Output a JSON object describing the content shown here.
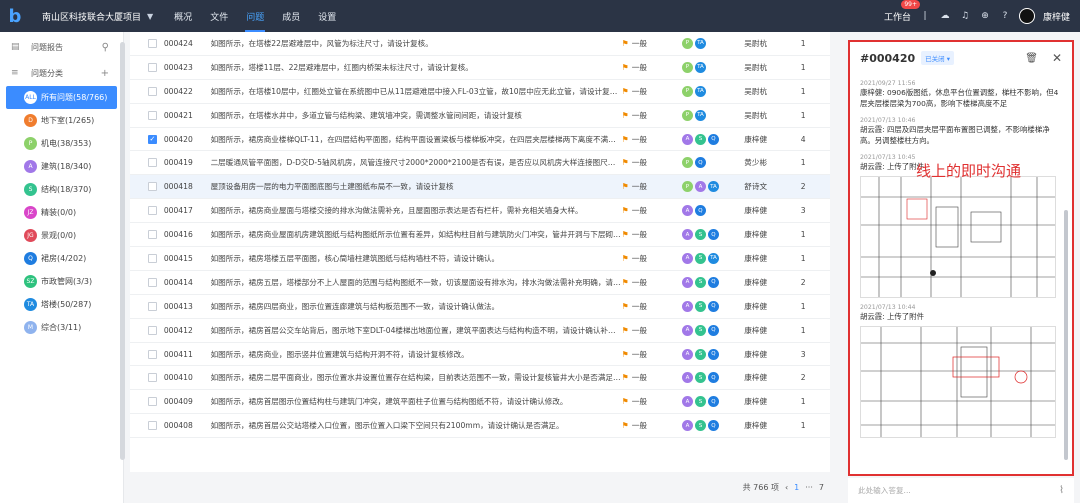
{
  "topbar": {
    "logo": "b",
    "project": "南山区科技联合大厦项目",
    "tabs": [
      "概况",
      "文件",
      "问题",
      "成员",
      "设置"
    ],
    "active_tab": 2,
    "workbench": "工作台",
    "badge": "99+",
    "user": "康梓健"
  },
  "sidebar": {
    "report": "问题报告",
    "category": "问题分类",
    "categories": [
      {
        "badge": "ALL",
        "label": "所有问题(58/766)",
        "color": "#3b8cff"
      },
      {
        "badge": "D",
        "label": "地下室(1/265)",
        "color": "#f07d2e"
      },
      {
        "badge": "P",
        "label": "机电(38/353)",
        "color": "#8dd16a"
      },
      {
        "badge": "A",
        "label": "建筑(18/340)",
        "color": "#a178e8"
      },
      {
        "badge": "S",
        "label": "结构(18/370)",
        "color": "#34c38f"
      },
      {
        "badge": "JZ",
        "label": "精装(0/0)",
        "color": "#d946c9"
      },
      {
        "badge": "JG",
        "label": "景观(0/0)",
        "color": "#e04a5a"
      },
      {
        "badge": "Q",
        "label": "裙房(4/202)",
        "color": "#1f7de0"
      },
      {
        "badge": "SZ",
        "label": "市政管网(3/3)",
        "color": "#2ec27e"
      },
      {
        "badge": "TA",
        "label": "塔楼(50/287)",
        "color": "#1f8be0"
      },
      {
        "badge": "M",
        "label": "综合(3/11)",
        "color": "#8fb3ee"
      }
    ]
  },
  "rows": [
    {
      "id": "000424",
      "desc": "如图所示，在塔楼22层避难层中，风管为标注尺寸，请设计复核。",
      "tags": [
        "P",
        "TA"
      ],
      "owner": "吴尉杭",
      "count": "1"
    },
    {
      "id": "000423",
      "desc": "如图所示，塔楼11层、22层避难层中，红圈内桥架未标注尺寸，请设计复核。",
      "tags": [
        "P",
        "TA"
      ],
      "owner": "吴尉杭",
      "count": "1"
    },
    {
      "id": "000422",
      "desc": "如图所示，在塔楼10层中，红圈处立管在系统图中已从11层避难层中接入FL-03立管，故10层中应无此立管，请设计复核是...",
      "tags": [
        "P",
        "TA"
      ],
      "owner": "吴尉杭",
      "count": "1"
    },
    {
      "id": "000421",
      "desc": "如图所示，在塔楼水井中，多道立管与结构梁、建筑墙冲突，需调整水管间间距，请设计复核",
      "tags": [
        "P",
        "TA"
      ],
      "owner": "吴尉杭",
      "count": "1"
    },
    {
      "id": "000420",
      "desc": "如图所示，裙房商业楼梯QLT-11，在四层结构平面图，结构平面设置梁板与楼梯板冲突，在四层夹层楼梯两下离度不满足22...",
      "tags": [
        "A",
        "S",
        "Q"
      ],
      "owner": "康梓健",
      "count": "4",
      "checked": true
    },
    {
      "id": "000419",
      "desc": "二层暖通风管平面图，D-D交D-5轴风机房，风管连接尺寸2000*2000*2100是否有误，是否应以风机房大样连接图尺寸200...",
      "tags": [
        "P",
        "Q"
      ],
      "owner": "黄少彬",
      "count": "1"
    },
    {
      "id": "000418",
      "desc": "屋顶设备用房一层的电力平面图底图与土建图纸布局不一致，请设计复核",
      "tags": [
        "P",
        "A",
        "TA"
      ],
      "owner": "舒诗文",
      "count": "2",
      "hl": true
    },
    {
      "id": "000417",
      "desc": "如图所示，裙房商业屋面与塔楼交接的排水沟做法需补充，且屋面图示表达是否有栏杆，需补充相关墙身大样。",
      "tags": [
        "A",
        "Q"
      ],
      "owner": "康梓健",
      "count": "3"
    },
    {
      "id": "000416",
      "desc": "如图所示，裙房商业屋面机房建筑图纸与结构图纸所示位置有差异，如结构柱目前与建筑防火门冲突，管井开洞与下层砌体墙中...",
      "tags": [
        "A",
        "S",
        "Q"
      ],
      "owner": "康梓健",
      "count": "1"
    },
    {
      "id": "000415",
      "desc": "如图所示，裙房塔楼五层平面图，核心筒墙柱建筑图纸与结构墙柱不符，请设计确认。",
      "tags": [
        "A",
        "S",
        "TA"
      ],
      "owner": "康梓健",
      "count": "1"
    },
    {
      "id": "000414",
      "desc": "如图所示，裙房五层，塔楼部分不上人屋面的范围与结构图纸不一致，切该屋面设有排水沟，排水沟做法需补充明确，请设...",
      "tags": [
        "A",
        "S",
        "Q"
      ],
      "owner": "康梓健",
      "count": "2"
    },
    {
      "id": "000413",
      "desc": "如图所示，裙房四层商业，图示位置连廊建筑与结构板范围不一致，请设计确认做法。",
      "tags": [
        "A",
        "S",
        "Q"
      ],
      "owner": "康梓健",
      "count": "1"
    },
    {
      "id": "000412",
      "desc": "如图所示，裙房首层公交车站背后，图示地下室DLT-04楼梯出地面位置，建筑平面表达与结构构造不明，请设计确认补充平...",
      "tags": [
        "A",
        "S",
        "Q"
      ],
      "owner": "康梓健",
      "count": "1"
    },
    {
      "id": "000411",
      "desc": "如图所示，裙房商业，图示竖井位置建筑与结构开洞不符，请设计复核修改。",
      "tags": [
        "A",
        "S",
        "Q"
      ],
      "owner": "康梓健",
      "count": "3"
    },
    {
      "id": "000410",
      "desc": "如图所示，裙房二层平面商业，图示位置水井设置位置存在结构梁，目前表达范围不一致，需设计复核管井大小是否满足设...",
      "tags": [
        "A",
        "S",
        "Q"
      ],
      "owner": "康梓健",
      "count": "2"
    },
    {
      "id": "000409",
      "desc": "如图所示，裙房首层图示位置结构柱与建筑门冲突，建筑平面柱子位置与结构图纸不符，请设计确认修改。",
      "tags": [
        "A",
        "S",
        "Q"
      ],
      "owner": "康梓健",
      "count": "1"
    },
    {
      "id": "000408",
      "desc": "如图所示，裙房首层公交站塔楼入口位置，图示位置入口梁下空间只有2100mm，请设计确认是否满足。",
      "tags": [
        "A",
        "S",
        "Q"
      ],
      "owner": "康梓健",
      "count": "1"
    }
  ],
  "priority": "一般",
  "tag_colors": {
    "P": "#8dd16a",
    "TA": "#1f8be0",
    "A": "#a178e8",
    "S": "#34c38f",
    "Q": "#1f7de0"
  },
  "pager": {
    "total": "共 766 项",
    "prev": "‹",
    "page": "1",
    "sep": "···",
    "last": "7"
  },
  "panel": {
    "id": "#000420",
    "status": "已关闭 ▾",
    "annotation": "线上的即时沟通",
    "msgs": [
      {
        "time": "2021/09/27 11:56",
        "text": "康梓健: 0906版图纸，休息平台位置调整，梯柱不影响，但4层夹层楼层梁为700高，影响下楼梯高度不足"
      },
      {
        "time": "2021/07/13 10:46",
        "text": "胡云霞: 四层及四层夹层平面布置图已调整，不影响楼梯净高。另调整楼柱方向。"
      },
      {
        "time": "2021/07/13 10:45",
        "text": "胡云霞: 上传了附件"
      },
      {
        "time": "2021/07/13 10:44",
        "text": "胡云霞: 上传了附件"
      }
    ],
    "input_placeholder": "此处输入答复..."
  }
}
